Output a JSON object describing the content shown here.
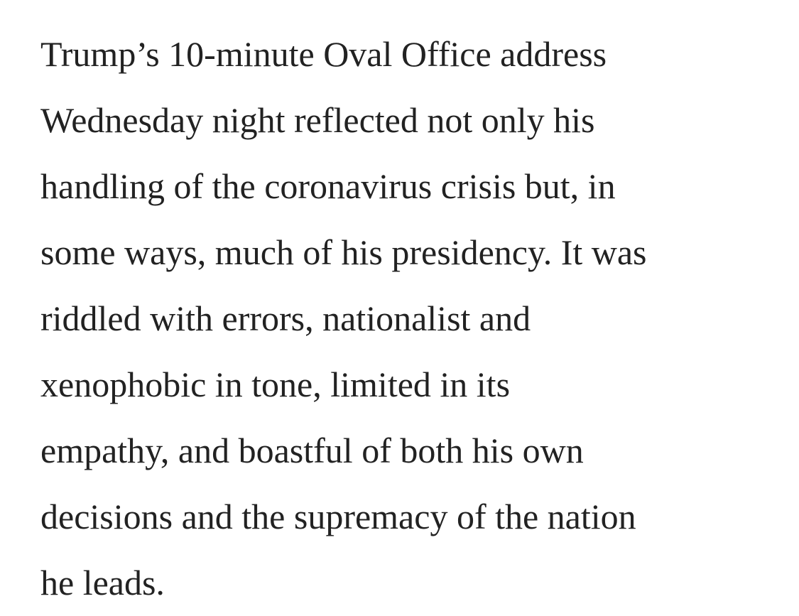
{
  "article": {
    "paragraph_lines": [
      "Trump’s 10-minute Oval Office address",
      "Wednesday night reflected not only his",
      "handling of the coronavirus crisis but, in",
      "some ways, much of his presidency. It was",
      "riddled with errors, nationalist and",
      "xenophobic in tone, limited in its",
      "empathy, and boastful of both his own",
      "decisions and the supremacy of the nation",
      "he leads."
    ]
  },
  "colors": {
    "background": "#ffffff",
    "text": "#222222"
  }
}
